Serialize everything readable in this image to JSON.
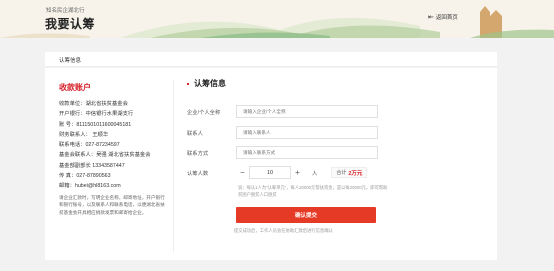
{
  "header": {
    "subtitle": "知名民企湖北行",
    "title": "我要认筹",
    "back_label": "返回首页"
  },
  "breadcrumb": "认筹信息",
  "account": {
    "title": "收款账户",
    "lines": [
      "收款单位：湖北省扶贫基金会",
      "开户银行：中信银行水果湖支行",
      "账 号：8111501011600045181",
      "财务联系人： 王顺华",
      "联系电话：027-87234597",
      "基金会联系人：吴强 湖北省扶贫基金会",
      "基金部副部长 13343587447",
      "传 真：027-87890563",
      "邮箱：hubei@hl8163.com"
    ],
    "note": "请企业汇款时，写明企业名称，邮寄地址，开户银行和银行账号，以及联系人和联系电话，以便湖北省扶贫基金会开具相应捐款发票和邮寄给企业。"
  },
  "form": {
    "title": "认筹信息",
    "fields": [
      {
        "label": "企业/个人全称",
        "placeholder": "请输入企业/个人全称"
      },
      {
        "label": "联系人",
        "placeholder": "请输入联系人"
      },
      {
        "label": "联系方式",
        "placeholder": "请输入联系方式"
      }
    ],
    "qty_label": "认筹人数",
    "qty_minus": "−",
    "qty_value": "10",
    "qty_plus": "+",
    "qty_unit": "人",
    "total_label": "合计",
    "total_amount": "2万元",
    "hint": "说：每认1人为“认筹单元”，每人20000元帮扶资金，是以每20000元。即可帮助贫困户脱贫人口脱贫",
    "submit_label": "确认提交",
    "foot_note": "提交成功后，工作人员会在协助汇款后进行信息确认"
  },
  "colors": {
    "accent": "#e53a25",
    "title_red": "#d6232a"
  }
}
